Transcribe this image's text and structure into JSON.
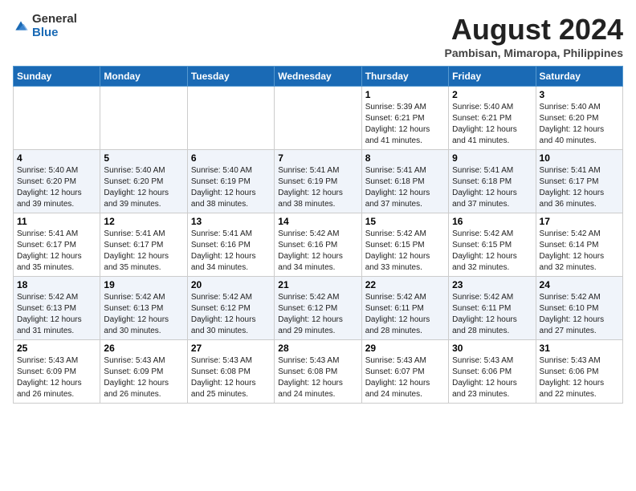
{
  "header": {
    "logo_general": "General",
    "logo_blue": "Blue",
    "title": "August 2024",
    "location": "Pambisan, Mimaropa, Philippines"
  },
  "days_of_week": [
    "Sunday",
    "Monday",
    "Tuesday",
    "Wednesday",
    "Thursday",
    "Friday",
    "Saturday"
  ],
  "weeks": [
    [
      {
        "day": "",
        "info": ""
      },
      {
        "day": "",
        "info": ""
      },
      {
        "day": "",
        "info": ""
      },
      {
        "day": "",
        "info": ""
      },
      {
        "day": "1",
        "info": "Sunrise: 5:39 AM\nSunset: 6:21 PM\nDaylight: 12 hours and 41 minutes."
      },
      {
        "day": "2",
        "info": "Sunrise: 5:40 AM\nSunset: 6:21 PM\nDaylight: 12 hours and 41 minutes."
      },
      {
        "day": "3",
        "info": "Sunrise: 5:40 AM\nSunset: 6:20 PM\nDaylight: 12 hours and 40 minutes."
      }
    ],
    [
      {
        "day": "4",
        "info": "Sunrise: 5:40 AM\nSunset: 6:20 PM\nDaylight: 12 hours and 39 minutes."
      },
      {
        "day": "5",
        "info": "Sunrise: 5:40 AM\nSunset: 6:20 PM\nDaylight: 12 hours and 39 minutes."
      },
      {
        "day": "6",
        "info": "Sunrise: 5:40 AM\nSunset: 6:19 PM\nDaylight: 12 hours and 38 minutes."
      },
      {
        "day": "7",
        "info": "Sunrise: 5:41 AM\nSunset: 6:19 PM\nDaylight: 12 hours and 38 minutes."
      },
      {
        "day": "8",
        "info": "Sunrise: 5:41 AM\nSunset: 6:18 PM\nDaylight: 12 hours and 37 minutes."
      },
      {
        "day": "9",
        "info": "Sunrise: 5:41 AM\nSunset: 6:18 PM\nDaylight: 12 hours and 37 minutes."
      },
      {
        "day": "10",
        "info": "Sunrise: 5:41 AM\nSunset: 6:17 PM\nDaylight: 12 hours and 36 minutes."
      }
    ],
    [
      {
        "day": "11",
        "info": "Sunrise: 5:41 AM\nSunset: 6:17 PM\nDaylight: 12 hours and 35 minutes."
      },
      {
        "day": "12",
        "info": "Sunrise: 5:41 AM\nSunset: 6:17 PM\nDaylight: 12 hours and 35 minutes."
      },
      {
        "day": "13",
        "info": "Sunrise: 5:41 AM\nSunset: 6:16 PM\nDaylight: 12 hours and 34 minutes."
      },
      {
        "day": "14",
        "info": "Sunrise: 5:42 AM\nSunset: 6:16 PM\nDaylight: 12 hours and 34 minutes."
      },
      {
        "day": "15",
        "info": "Sunrise: 5:42 AM\nSunset: 6:15 PM\nDaylight: 12 hours and 33 minutes."
      },
      {
        "day": "16",
        "info": "Sunrise: 5:42 AM\nSunset: 6:15 PM\nDaylight: 12 hours and 32 minutes."
      },
      {
        "day": "17",
        "info": "Sunrise: 5:42 AM\nSunset: 6:14 PM\nDaylight: 12 hours and 32 minutes."
      }
    ],
    [
      {
        "day": "18",
        "info": "Sunrise: 5:42 AM\nSunset: 6:13 PM\nDaylight: 12 hours and 31 minutes."
      },
      {
        "day": "19",
        "info": "Sunrise: 5:42 AM\nSunset: 6:13 PM\nDaylight: 12 hours and 30 minutes."
      },
      {
        "day": "20",
        "info": "Sunrise: 5:42 AM\nSunset: 6:12 PM\nDaylight: 12 hours and 30 minutes."
      },
      {
        "day": "21",
        "info": "Sunrise: 5:42 AM\nSunset: 6:12 PM\nDaylight: 12 hours and 29 minutes."
      },
      {
        "day": "22",
        "info": "Sunrise: 5:42 AM\nSunset: 6:11 PM\nDaylight: 12 hours and 28 minutes."
      },
      {
        "day": "23",
        "info": "Sunrise: 5:42 AM\nSunset: 6:11 PM\nDaylight: 12 hours and 28 minutes."
      },
      {
        "day": "24",
        "info": "Sunrise: 5:42 AM\nSunset: 6:10 PM\nDaylight: 12 hours and 27 minutes."
      }
    ],
    [
      {
        "day": "25",
        "info": "Sunrise: 5:43 AM\nSunset: 6:09 PM\nDaylight: 12 hours and 26 minutes."
      },
      {
        "day": "26",
        "info": "Sunrise: 5:43 AM\nSunset: 6:09 PM\nDaylight: 12 hours and 26 minutes."
      },
      {
        "day": "27",
        "info": "Sunrise: 5:43 AM\nSunset: 6:08 PM\nDaylight: 12 hours and 25 minutes."
      },
      {
        "day": "28",
        "info": "Sunrise: 5:43 AM\nSunset: 6:08 PM\nDaylight: 12 hours and 24 minutes."
      },
      {
        "day": "29",
        "info": "Sunrise: 5:43 AM\nSunset: 6:07 PM\nDaylight: 12 hours and 24 minutes."
      },
      {
        "day": "30",
        "info": "Sunrise: 5:43 AM\nSunset: 6:06 PM\nDaylight: 12 hours and 23 minutes."
      },
      {
        "day": "31",
        "info": "Sunrise: 5:43 AM\nSunset: 6:06 PM\nDaylight: 12 hours and 22 minutes."
      }
    ]
  ]
}
